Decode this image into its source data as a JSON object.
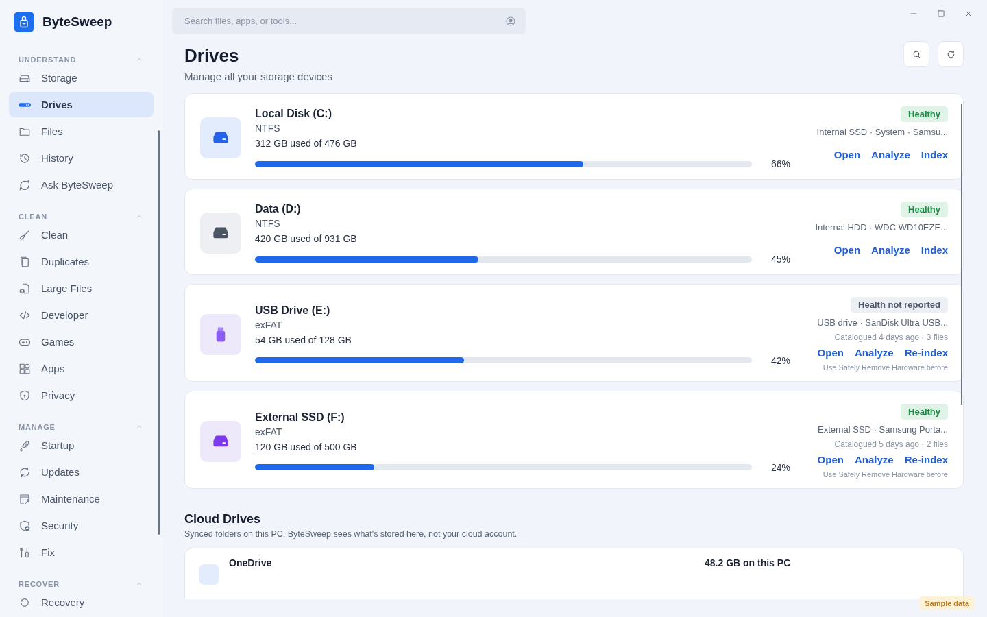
{
  "app": {
    "name": "ByteSweep"
  },
  "sidebar": {
    "sections": [
      {
        "title": "UNDERSTAND",
        "expanded": true,
        "items": [
          {
            "label": "Storage",
            "kind": "storage",
            "selected": false
          },
          {
            "label": "Drives",
            "kind": "drive",
            "selected": true
          },
          {
            "label": "Files",
            "kind": "folder",
            "selected": false
          },
          {
            "label": "History",
            "kind": "history",
            "selected": false
          },
          {
            "label": "Ask ByteSweep",
            "kind": "chat",
            "selected": false
          }
        ]
      },
      {
        "title": "CLEAN",
        "expanded": true,
        "items": [
          {
            "label": "Clean",
            "kind": "broom",
            "selected": false
          },
          {
            "label": "Duplicates",
            "kind": "copy",
            "selected": false
          },
          {
            "label": "Large Files",
            "kind": "bigfile",
            "selected": false
          },
          {
            "label": "Developer",
            "kind": "code",
            "selected": false
          },
          {
            "label": "Games",
            "kind": "gamepad",
            "selected": false
          },
          {
            "label": "Apps",
            "kind": "apps",
            "selected": false
          },
          {
            "label": "Privacy",
            "kind": "shield",
            "selected": false
          }
        ]
      },
      {
        "title": "MANAGE",
        "expanded": true,
        "items": [
          {
            "label": "Startup",
            "kind": "rocket",
            "selected": false
          },
          {
            "label": "Updates",
            "kind": "refresh",
            "selected": false
          },
          {
            "label": "Maintenance",
            "kind": "wrench",
            "selected": false
          },
          {
            "label": "Security",
            "kind": "shieldcheck",
            "selected": false
          },
          {
            "label": "Fix",
            "kind": "tools",
            "selected": false
          }
        ]
      },
      {
        "title": "RECOVER",
        "expanded": true,
        "items": [
          {
            "label": "Recovery",
            "kind": "undo",
            "selected": false
          }
        ]
      }
    ]
  },
  "search": {
    "placeholder": "Search files, apps, or tools..."
  },
  "page": {
    "title": "Drives",
    "subtitle": "Manage all your storage devices"
  },
  "drives": [
    {
      "kind": "ssd",
      "name": "Local Disk (C:)",
      "filesystem": "NTFS",
      "usage": "312 GB used of 476 GB",
      "level": 0.66,
      "percent": "66%",
      "health": {
        "kind": "good",
        "label": "Healthy"
      },
      "model": "Internal SSD · System · Samsu...",
      "actions": [
        "Open",
        "Analyze",
        "Index"
      ]
    },
    {
      "kind": "hdd",
      "name": "Data (D:)",
      "filesystem": "NTFS",
      "usage": "420 GB used of 931 GB",
      "level": 0.45,
      "percent": "45%",
      "health": {
        "kind": "good",
        "label": "Healthy"
      },
      "model": "Internal HDD · WDC WD10EZE...",
      "actions": [
        "Open",
        "Analyze",
        "Index"
      ]
    },
    {
      "kind": "usb",
      "name": "USB Drive (E:)",
      "filesystem": "exFAT",
      "usage": "54 GB used of 128 GB",
      "level": 0.42,
      "percent": "42%",
      "health": {
        "kind": "unknown",
        "label": "Health not reported"
      },
      "model": "USB drive · SanDisk Ultra USB...",
      "catalogued": "Catalogued 4 days ago · 3 files",
      "actions": [
        "Open",
        "Analyze",
        "Re-index"
      ],
      "note": "Use Safely Remove Hardware before"
    },
    {
      "kind": "external",
      "name": "External SSD (F:)",
      "filesystem": "exFAT",
      "usage": "120 GB used of 500 GB",
      "level": 0.24,
      "percent": "24%",
      "health": {
        "kind": "good",
        "label": "Healthy"
      },
      "model": "External SSD · Samsung Porta...",
      "catalogued": "Catalogued 5 days ago · 2 files",
      "actions": [
        "Open",
        "Analyze",
        "Re-index"
      ],
      "note": "Use Safely Remove Hardware before"
    }
  ],
  "cloud": {
    "title": "Cloud Drives",
    "subtitle": "Synced folders on this PC. ByteSweep sees what's stored here, not your cloud account.",
    "items": [
      {
        "name": "OneDrive",
        "size": "48.2 GB on this PC"
      }
    ]
  },
  "badge": "Sample data"
}
